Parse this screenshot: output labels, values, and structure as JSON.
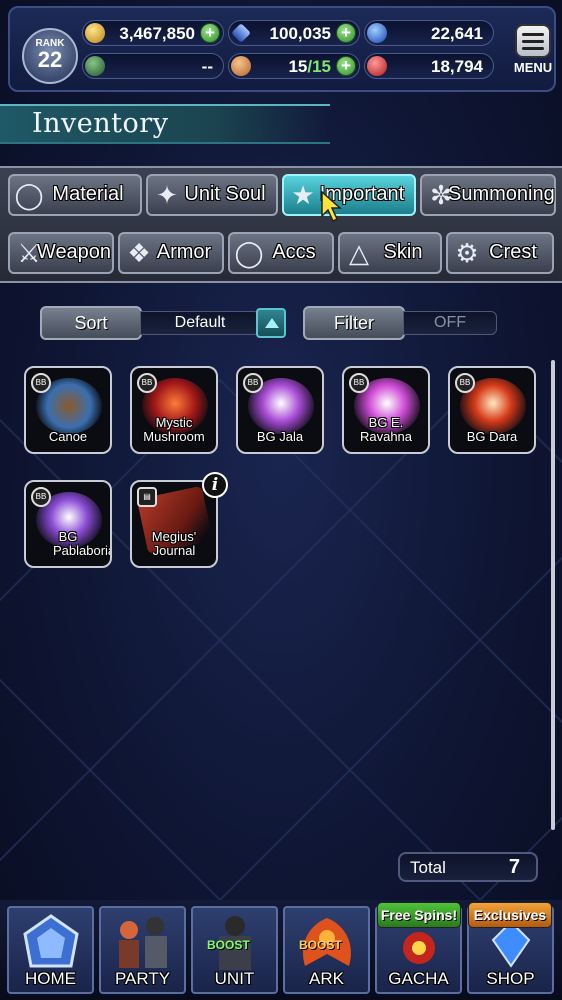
{
  "header": {
    "rank_label": "RANK",
    "rank_value": "22",
    "gil": "3,467,850",
    "lapis": "100,035",
    "blue_resource": "22,641",
    "guild_value": "--",
    "stamina_current": "15",
    "stamina_max": "/15",
    "red_resource": "18,794",
    "menu_label": "MENU",
    "plus_symbol": "+"
  },
  "title": "Inventory",
  "tabs": [
    {
      "label": "Material",
      "icon": "bag-icon",
      "active": false
    },
    {
      "label": "Unit Soul",
      "icon": "soul-icon",
      "active": false
    },
    {
      "label": "Important",
      "icon": "star-icon",
      "active": true
    },
    {
      "label": "Summoning",
      "icon": "summon-icon",
      "active": false
    },
    {
      "label": "Weapon",
      "icon": "sword-icon",
      "active": false
    },
    {
      "label": "Armor",
      "icon": "armor-icon",
      "active": false
    },
    {
      "label": "Accs",
      "icon": "ring-icon",
      "active": false
    },
    {
      "label": "Skin",
      "icon": "hanger-icon",
      "active": false
    },
    {
      "label": "Crest",
      "icon": "crest-icon",
      "active": false
    }
  ],
  "sort": {
    "label": "Sort",
    "value": "Default"
  },
  "filter": {
    "label": "Filter",
    "value": "OFF"
  },
  "items": [
    {
      "name": "Canoe"
    },
    {
      "name": "Mystic Mushroom"
    },
    {
      "name": "BG Jala"
    },
    {
      "name": "BG E. Ravahna"
    },
    {
      "name": "BG Dara"
    },
    {
      "name": "BG Pablaboria"
    },
    {
      "name": "Megius' Journal"
    }
  ],
  "total": {
    "label": "Total",
    "value": "7"
  },
  "nav": [
    {
      "label": "HOME"
    },
    {
      "label": "PARTY"
    },
    {
      "label": "UNIT",
      "tag": "BOOST"
    },
    {
      "label": "ARK",
      "tag": "BOOST"
    },
    {
      "label": "GACHA",
      "ribbon": "Free Spins!"
    },
    {
      "label": "SHOP",
      "ribbon": "Exclusives"
    }
  ],
  "colors": {
    "accent": "#3fbfcc",
    "panel": "#1c2a57",
    "ribbon_green": "#3c9a2e",
    "ribbon_orange": "#c86a16"
  }
}
